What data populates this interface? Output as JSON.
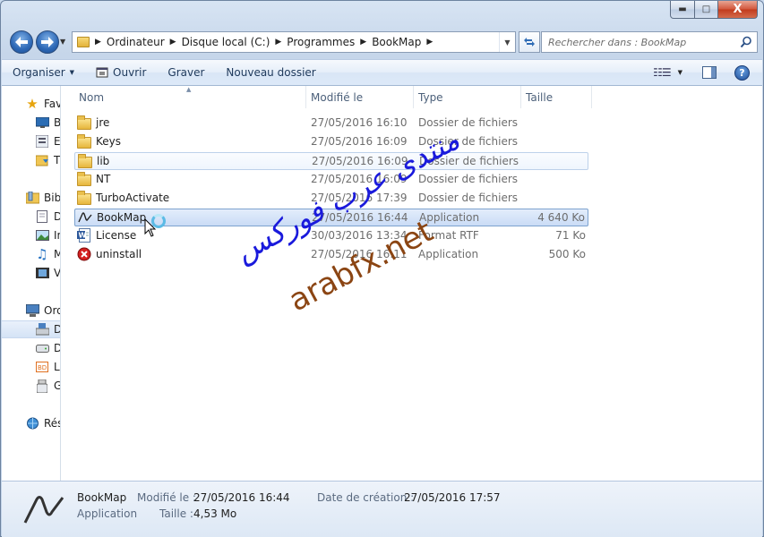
{
  "window": {
    "caption_buttons": {
      "minimize": "▬",
      "maximize": "□",
      "close": "X"
    }
  },
  "navigation": {
    "back_icon": "back-arrow-icon",
    "forward_icon": "forward-arrow-icon",
    "breadcrumb": [
      "Ordinateur",
      "Disque local (C:)",
      "Programmes",
      "BookMap"
    ],
    "search_placeholder": "Rechercher dans : BookMap"
  },
  "command_bar": {
    "organize": "Organiser",
    "open": "Ouvrir",
    "burn": "Graver",
    "new_folder": "Nouveau dossier"
  },
  "nav_pane": {
    "favorites": "Fav",
    "fav_items": [
      "B",
      "E",
      "T"
    ],
    "libraries": "Bib",
    "lib_items": [
      "D",
      "Im",
      "M",
      "V"
    ],
    "computer": "Ord",
    "comp_items": [
      "D",
      "D",
      "L",
      "G"
    ],
    "network": "Rés"
  },
  "columns": {
    "name": "Nom",
    "modified": "Modifié le",
    "type": "Type",
    "size": "Taille"
  },
  "files": [
    {
      "name": "jre",
      "date": "27/05/2016 16:10",
      "type": "Dossier de fichiers",
      "size": "",
      "icon": "folder-icon"
    },
    {
      "name": "Keys",
      "date": "27/05/2016 16:09",
      "type": "Dossier de fichiers",
      "size": "",
      "icon": "folder-icon"
    },
    {
      "name": "lib",
      "date": "27/05/2016 16:09",
      "type": "Dossier de fichiers",
      "size": "",
      "icon": "folder-icon"
    },
    {
      "name": "NT",
      "date": "27/05/2016 16:09",
      "type": "Dossier de fichiers",
      "size": "",
      "icon": "folder-icon"
    },
    {
      "name": "TurboActivate",
      "date": "27/05/2016 17:39",
      "type": "Dossier de fichiers",
      "size": "",
      "icon": "folder-icon"
    },
    {
      "name": "BookMap",
      "date": "27/05/2016 16:44",
      "type": "Application",
      "size": "4 640 Ko",
      "icon": "bookmap-app-icon"
    },
    {
      "name": "License",
      "date": "30/03/2016 13:34",
      "type": "Format RTF",
      "size": "71 Ko",
      "icon": "rtf-document-icon"
    },
    {
      "name": "uninstall",
      "date": "27/05/2016 16:11",
      "type": "Application",
      "size": "500 Ko",
      "icon": "uninstall-icon"
    }
  ],
  "watermark": {
    "arabic": "منتدى عرب فوركس",
    "latin": "arabfx.net"
  },
  "details": {
    "name": "BookMap",
    "kind": "Application",
    "modified_label": "Modifié le :",
    "modified_value": "27/05/2016 16:44",
    "size_label": "Taille :",
    "size_value": "4,53 Mo",
    "created_label": "Date de création :",
    "created_value": "27/05/2016 17:57"
  }
}
